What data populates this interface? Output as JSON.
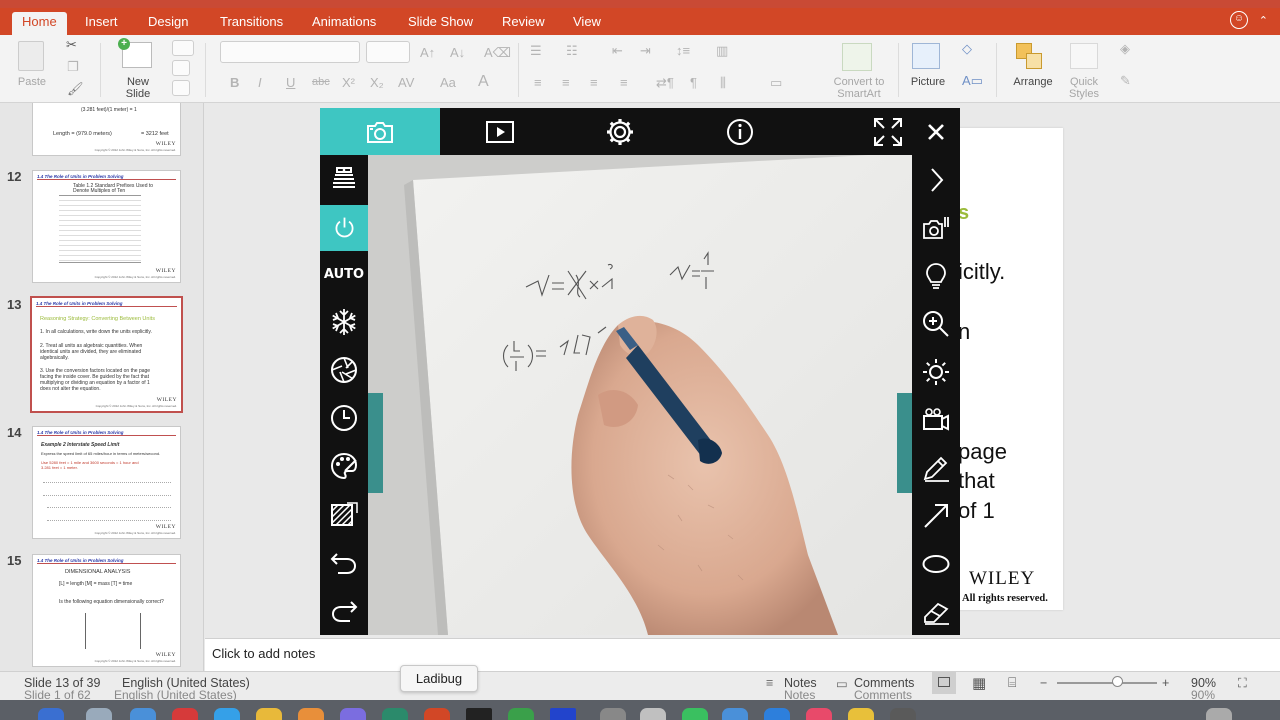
{
  "ribbon": {
    "tabs": [
      "Home",
      "Insert",
      "Design",
      "Transitions",
      "Animations",
      "Slide Show",
      "Review",
      "View"
    ],
    "paste_label": "Paste",
    "new_slide_label": "New\nSlide",
    "convert_label": "Convert to\nSmartArt",
    "picture_label": "Picture",
    "arrange_label": "Arrange",
    "quick_styles_label": "Quick\nStyles",
    "bold": "B",
    "italic": "I",
    "underline": "U",
    "strike": "abc",
    "superscript": "X²",
    "subscript": "X₂"
  },
  "slides": [
    {
      "number": "12",
      "title": "1.4 The Role of Units in Problem Solving",
      "lines": [
        "Table 1.2   Standard Prefixes Used to",
        "Denote Multiples of Ten"
      ]
    },
    {
      "number": "13",
      "title": "1.4 The Role of Units in Problem Solving",
      "heading": "Reasoning Strategy: Converting Between Units",
      "lines": [
        "1.  In all calculations, write down the units explicitly.",
        "2.  Treat all units as algebraic quantities.  When",
        "identical units are divided, they are eliminated",
        "algebraically.",
        "3.  Use the conversion factors located on the page",
        "facing the inside cover.  Be guided by the fact that",
        "multiplying or dividing an equation by a factor of 1",
        "does not alter the equation."
      ]
    },
    {
      "number": "14",
      "title": "1.4 The Role of Units in Problem Solving",
      "heading": "Example 2  Interstate Speed Limit",
      "lines": [
        "Express the speed limit of 65 miles/hour in terms of meters/second.",
        "Use 5280 feet = 1 mile and 3600 seconds = 1 hour and",
        "3.281 feet = 1 meter."
      ]
    },
    {
      "number": "15",
      "title": "1.4 The Role of Units in Problem Solving",
      "heading": "DIMENSIONAL ANALYSIS",
      "lines": [
        "[L] = length    [M] = mass    [T] = time",
        "Is the following equation dimensionally correct?"
      ]
    }
  ],
  "top_thumb_text": [
    "(3.281 feet)/(1 meter) = 1",
    "Length = (979.0 meters)",
    "= 3212 feet"
  ],
  "thumb_brand": "WILEY",
  "thumb_copyright": "Copyright © 2012 John Wiley & Sons, Inc. All rights reserved.",
  "main_slide": {
    "green_fragment": "s",
    "fragments": [
      "icitly.",
      "n",
      "page",
      "that",
      "of 1"
    ],
    "brand": "WILEY",
    "rights": "All rights reserved."
  },
  "notes_placeholder": "Click to add notes",
  "status": {
    "slide_count": "Slide 13 of 39",
    "language": "English (United States)",
    "ghost_slide": "Slide 1 of 62",
    "ghost_language": "English (United States)",
    "notes": "Notes",
    "comments": "Comments",
    "zoom": "90%",
    "zoom_level": 0.6
  },
  "tooltip": "Ladibug",
  "camera": {
    "auto_label": "AUTO",
    "active_tab": "capture",
    "accent": "#3ec6c2"
  }
}
